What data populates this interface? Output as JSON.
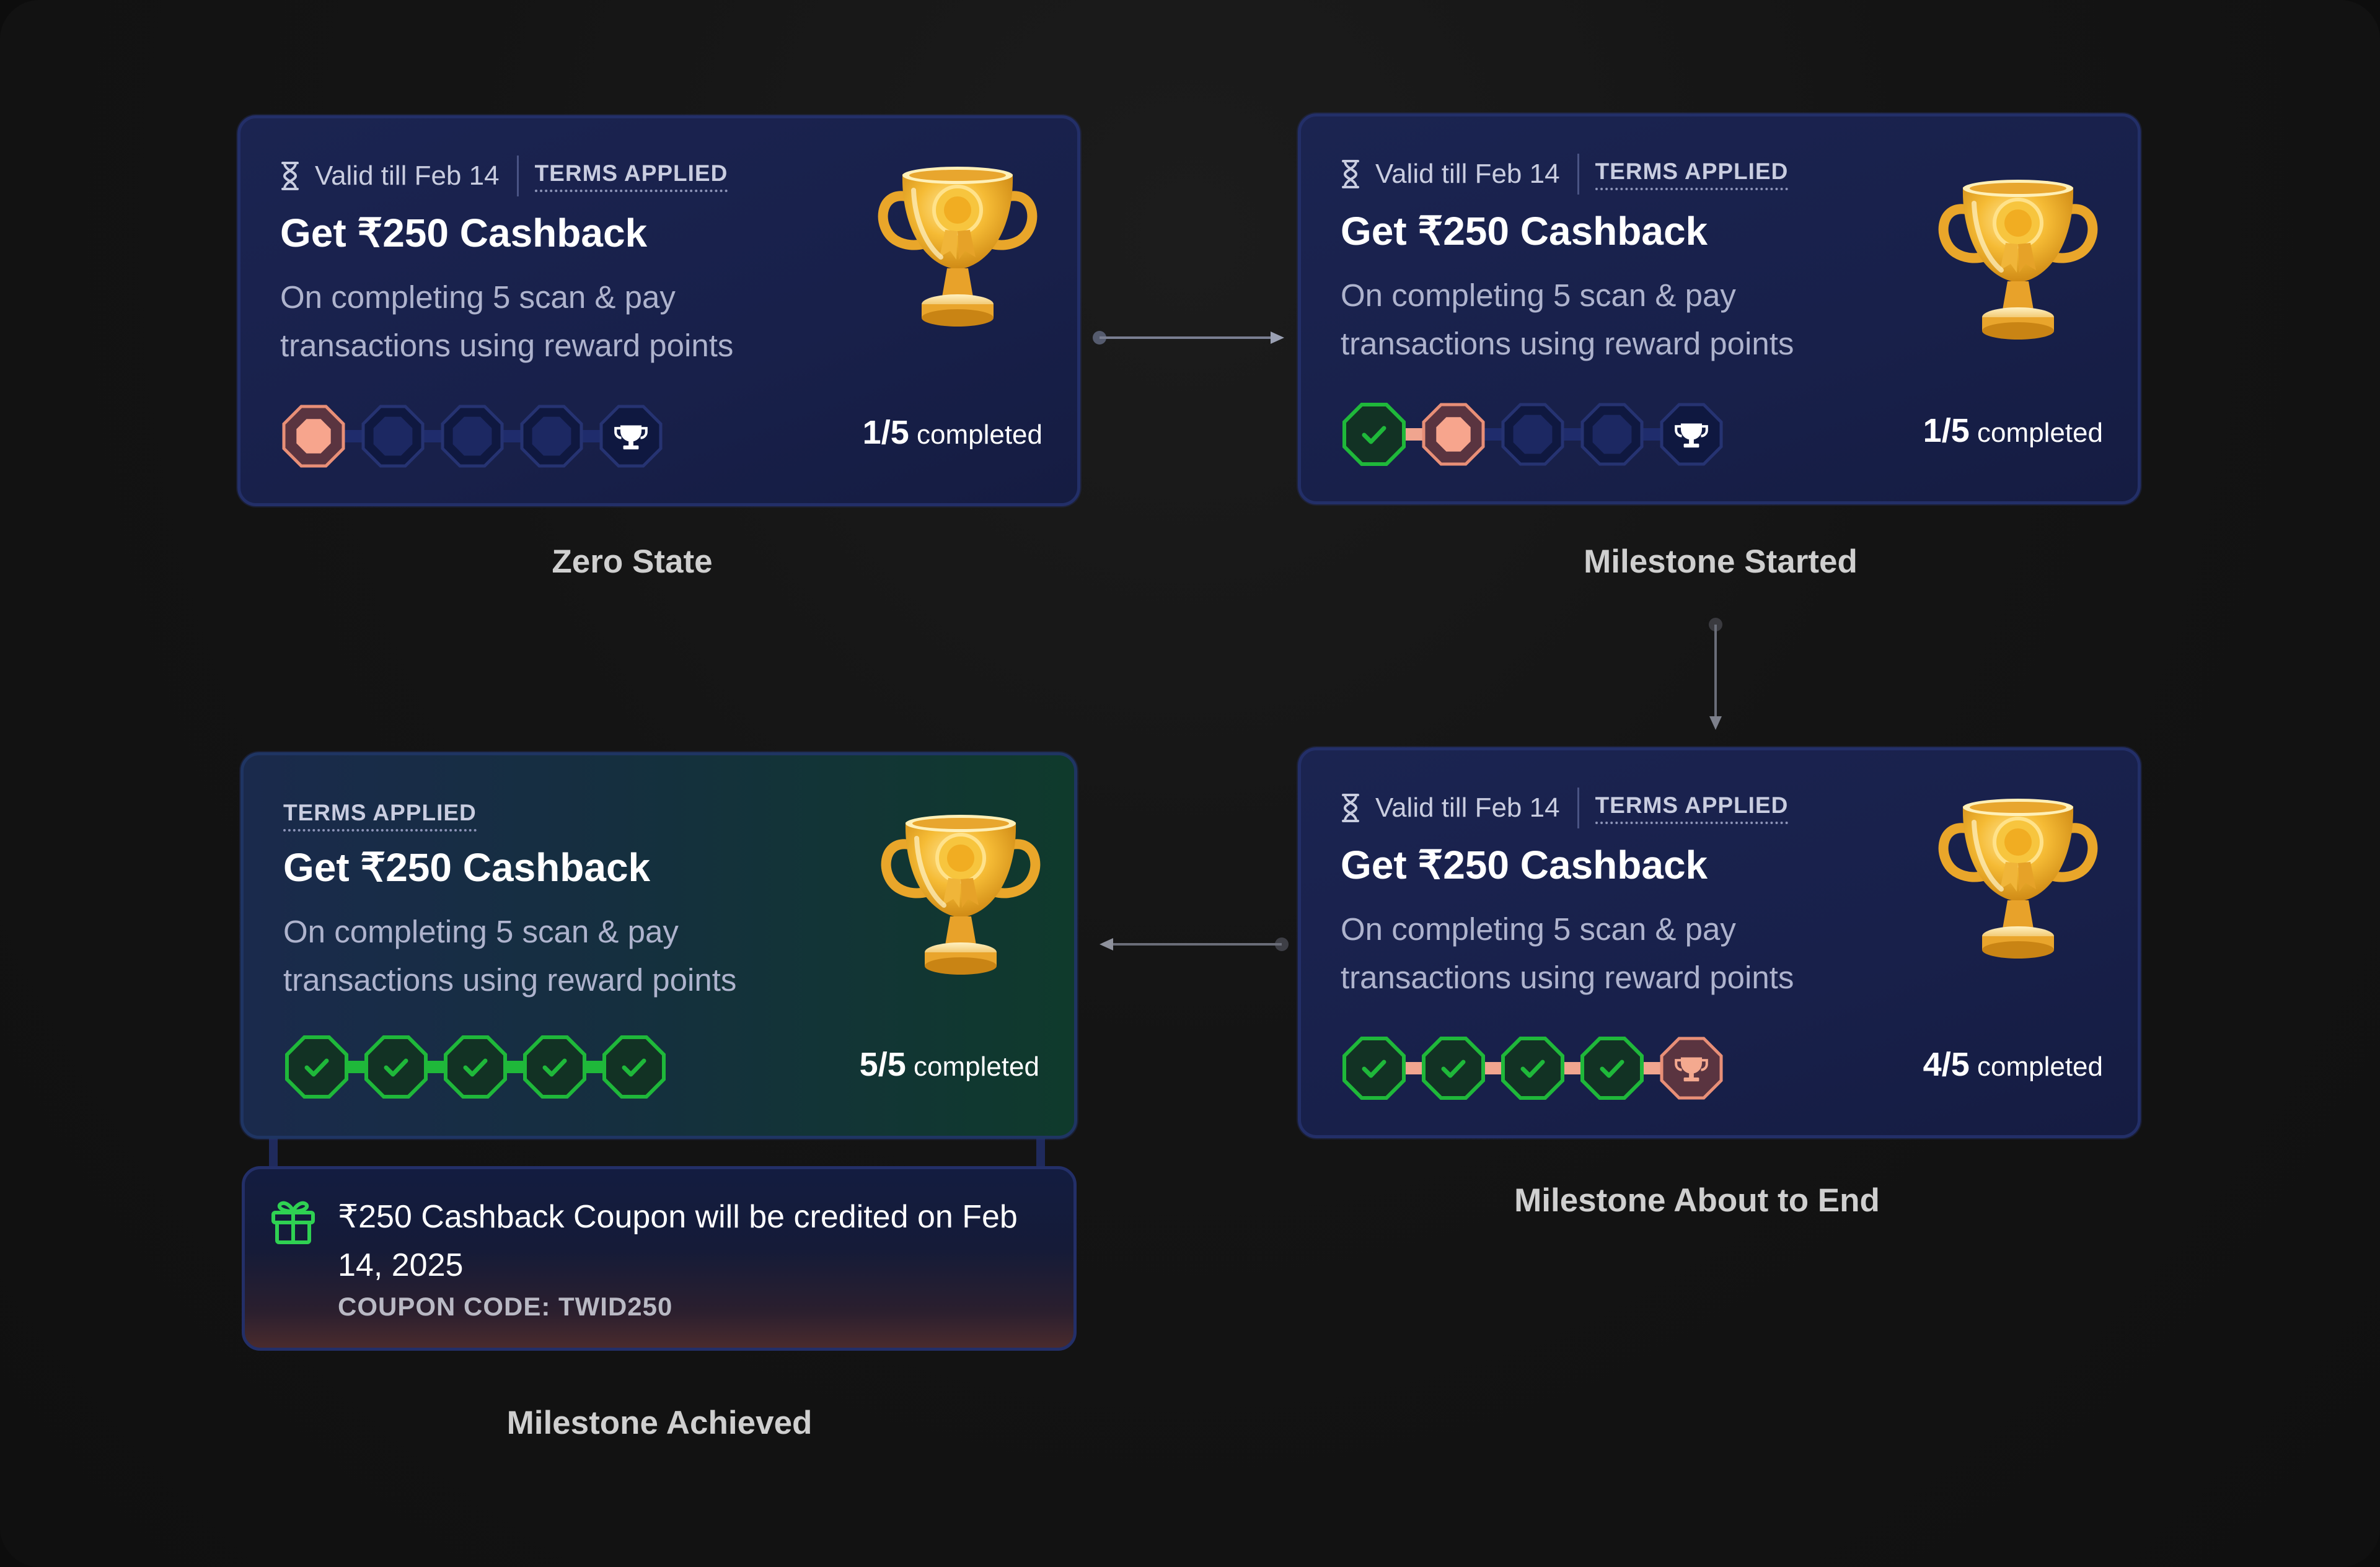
{
  "card_text": {
    "valid": "Valid till Feb 14",
    "terms": "TERMS APPLIED",
    "title": "Get ₹250 Cashback",
    "description": "On completing 5 scan & pay transactions using reward points",
    "completed_word": "completed"
  },
  "cards": {
    "zero": {
      "count": "1/5",
      "steps": [
        "current",
        "empty",
        "empty",
        "empty",
        "trophy"
      ]
    },
    "started": {
      "count": "1/5",
      "steps": [
        "done",
        "current",
        "empty",
        "empty",
        "trophy"
      ]
    },
    "ending": {
      "count": "4/5",
      "steps": [
        "done",
        "done",
        "done",
        "done",
        "trophy-current"
      ]
    },
    "achieved": {
      "count": "5/5",
      "steps": [
        "done",
        "done",
        "done",
        "done",
        "done"
      ]
    }
  },
  "labels": {
    "zero": "Zero State",
    "started": "Milestone Started",
    "ending": "Milestone About to  End",
    "achieved": "Milestone Achieved"
  },
  "coupon": {
    "text": "₹250 Cashback Coupon will be credited on Feb 14, 2025",
    "code": "COUPON CODE: TWID250",
    "icon": "gift-icon"
  },
  "icons": {
    "timer": "hourglass-icon",
    "reward": "trophy-icon",
    "check": "check-icon"
  },
  "colors": {
    "background": "#121212",
    "card": "#1b2451",
    "card_border": "#232f68",
    "done_green": "#1fb83a",
    "current_peach": "#ee9a82",
    "empty_node": "#0f1840",
    "gold": "#f2b32c"
  }
}
